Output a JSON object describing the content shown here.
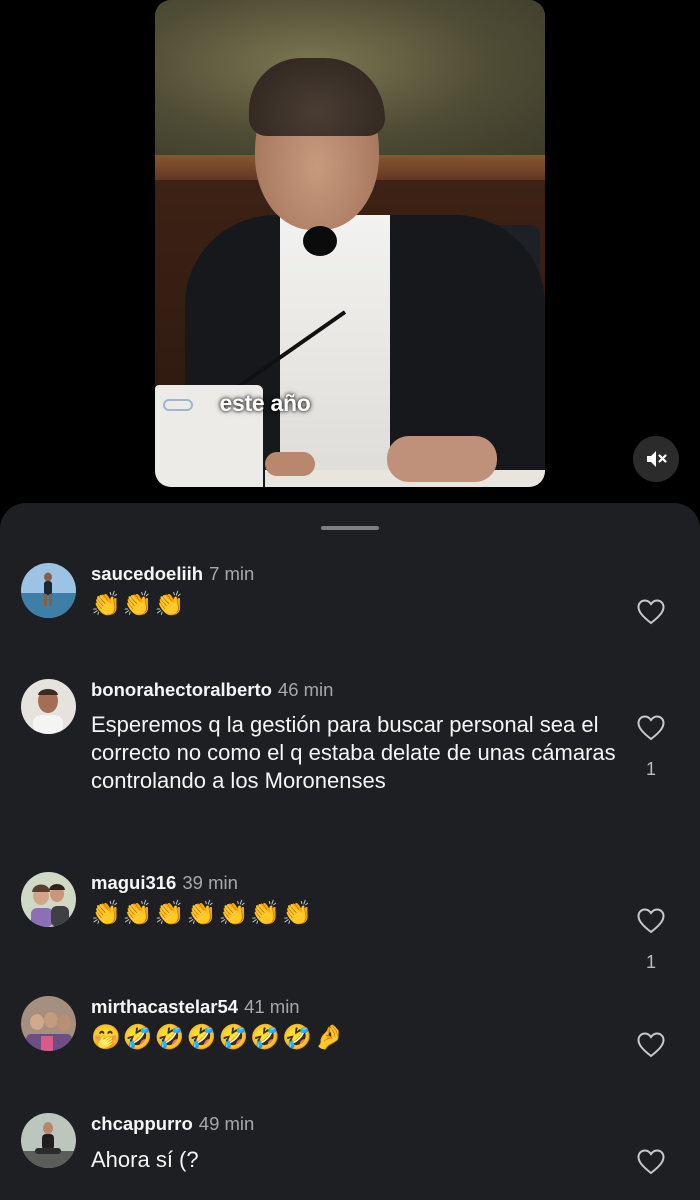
{
  "video": {
    "caption": "este año",
    "mute_icon": "speaker-muted-icon"
  },
  "comments": [
    {
      "username": "saucedoeliih",
      "time": "7 min",
      "text": "👏👏👏",
      "likes": "",
      "avatar_colors": [
        "#8fb4d9",
        "#3b6d93"
      ]
    },
    {
      "username": "bonorahectoralberto",
      "time": "46 min",
      "text": "Esperemos q la gestión para buscar personal sea el correcto no como el q estaba delate de unas cámaras controlando a los Moronenses",
      "likes": "1",
      "avatar_colors": [
        "#d9cfc7",
        "#6d5a4d"
      ]
    },
    {
      "username": "magui316",
      "time": "39 min",
      "text": "👏👏👏👏👏👏👏",
      "likes": "1",
      "avatar_colors": [
        "#c8d6bf",
        "#6e7a5b"
      ]
    },
    {
      "username": "mirthacastelar54",
      "time": "41 min",
      "text": "🤭🤣🤣🤣🤣🤣🤣🤌",
      "likes": "",
      "avatar_colors": [
        "#9e8574",
        "#4b3a32"
      ]
    },
    {
      "username": "chcappurro",
      "time": "49 min",
      "text": "Ahora sí (?",
      "likes": "",
      "avatar_colors": [
        "#b9c2b5",
        "#3f4a3d"
      ]
    }
  ]
}
